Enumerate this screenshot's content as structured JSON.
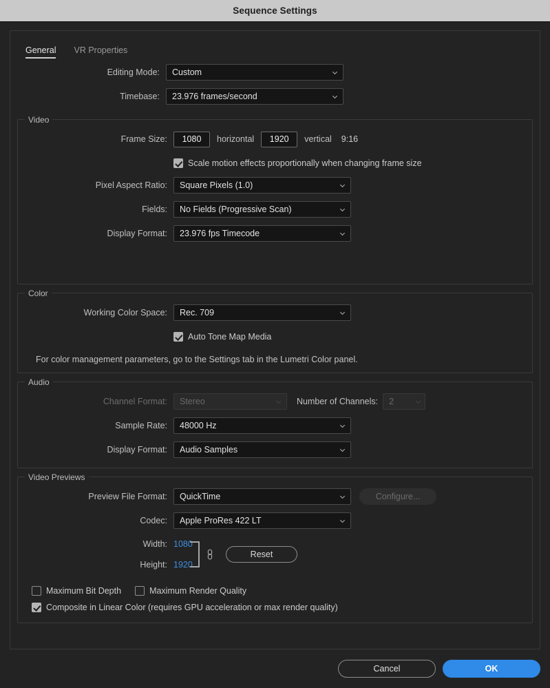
{
  "window": {
    "title": "Sequence Settings"
  },
  "tabs": [
    {
      "label": "General",
      "active": true
    },
    {
      "label": "VR Properties",
      "active": false
    }
  ],
  "general": {
    "editing_mode_label": "Editing Mode:",
    "editing_mode_value": "Custom",
    "timebase_label": "Timebase:",
    "timebase_value": "23.976  frames/second"
  },
  "video": {
    "title": "Video",
    "frame_size_label": "Frame Size:",
    "frame_width": "1080",
    "horizontal_text": "horizontal",
    "frame_height": "1920",
    "vertical_text": "vertical",
    "aspect_ratio_text": "9:16",
    "scale_motion_label": "Scale motion effects proportionally when changing frame size",
    "scale_motion_checked": true,
    "pixel_aspect_label": "Pixel Aspect Ratio:",
    "pixel_aspect_value": "Square Pixels (1.0)",
    "fields_label": "Fields:",
    "fields_value": "No Fields (Progressive Scan)",
    "display_format_label": "Display Format:",
    "display_format_value": "23.976 fps Timecode"
  },
  "color": {
    "title": "Color",
    "working_space_label": "Working Color Space:",
    "working_space_value": "Rec. 709",
    "auto_tone_label": "Auto Tone Map Media",
    "auto_tone_checked": true,
    "note": "For color management parameters, go to the Settings tab in the Lumetri Color panel."
  },
  "audio": {
    "title": "Audio",
    "channel_format_label": "Channel Format:",
    "channel_format_value": "Stereo",
    "channel_format_disabled": true,
    "num_channels_label": "Number of Channels:",
    "num_channels_value": "2",
    "num_channels_disabled": true,
    "sample_rate_label": "Sample Rate:",
    "sample_rate_value": "48000 Hz",
    "display_format_label": "Display Format:",
    "display_format_value": "Audio Samples"
  },
  "video_previews": {
    "title": "Video Previews",
    "preview_format_label": "Preview File Format:",
    "preview_format_value": "QuickTime",
    "configure_label": "Configure...",
    "configure_disabled": true,
    "codec_label": "Codec:",
    "codec_value": "Apple ProRes 422 LT",
    "width_label": "Width:",
    "width_value": "1080",
    "height_label": "Height:",
    "height_value": "1920",
    "reset_label": "Reset",
    "max_bit_depth_label": "Maximum Bit Depth",
    "max_bit_depth_checked": false,
    "max_render_quality_label": "Maximum Render Quality",
    "max_render_quality_checked": false,
    "composite_linear_label": "Composite in Linear Color (requires GPU acceleration or max render quality)",
    "composite_linear_checked": true
  },
  "footer": {
    "cancel_label": "Cancel",
    "ok_label": "OK"
  },
  "colors": {
    "accent_blue": "#2f8ae8",
    "hot_text_blue": "#3e8fe0",
    "titlebar_bg": "#c9c9c9",
    "dialog_bg": "#232323"
  }
}
